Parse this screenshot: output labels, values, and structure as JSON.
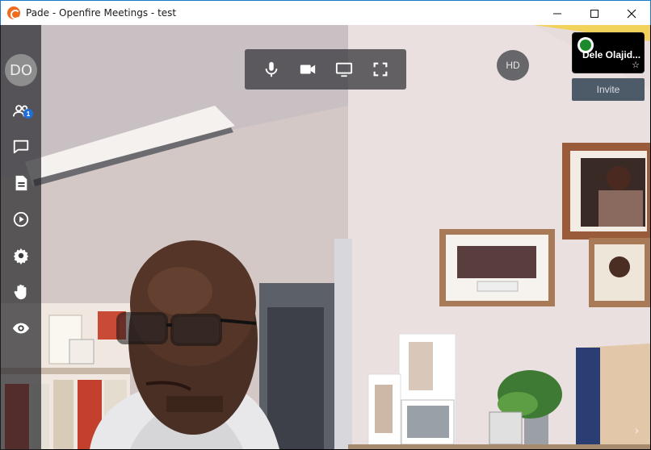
{
  "window": {
    "title": "Pade - Openfire Meetings - test"
  },
  "sidebar": {
    "avatar_initials": "DO",
    "participants_count": "1",
    "items": [
      {
        "name": "participants",
        "icon": "participants-icon"
      },
      {
        "name": "chat",
        "icon": "chat-icon"
      },
      {
        "name": "document",
        "icon": "document-icon"
      },
      {
        "name": "play",
        "icon": "play-icon"
      },
      {
        "name": "settings",
        "icon": "gear-icon"
      },
      {
        "name": "raise-hand",
        "icon": "hand-icon"
      },
      {
        "name": "view",
        "icon": "eye-icon"
      }
    ]
  },
  "controls": {
    "items": [
      "microphone-icon",
      "camera-icon",
      "screen-share-icon",
      "fullscreen-icon"
    ]
  },
  "quality": {
    "label": "HD"
  },
  "participant": {
    "name": "Dele Olajid..."
  },
  "invite": {
    "label": "Invite"
  },
  "colors": {
    "toolbar": "#28282d",
    "badge": "#1e6fd9",
    "status": "#1a8a2a",
    "invite": "#4d5a68"
  }
}
